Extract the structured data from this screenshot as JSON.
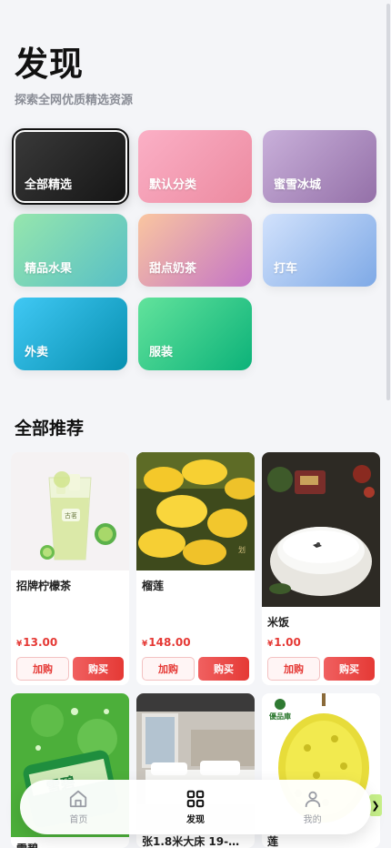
{
  "header": {
    "title": "发现",
    "subtitle": "探索全网优质精选资源"
  },
  "categories": [
    {
      "label": "全部精选",
      "active": true,
      "gradient": [
        "#3a3a3a",
        "#1a1a1a"
      ]
    },
    {
      "label": "默认分类",
      "active": false,
      "gradient": [
        "#f9a8c0",
        "#ee8ea3"
      ]
    },
    {
      "label": "蜜雪冰城",
      "active": false,
      "gradient": [
        "#c6a9d6",
        "#9b74ad"
      ]
    },
    {
      "label": "精品水果",
      "active": false,
      "gradient": [
        "#8fe3ae",
        "#5ec4c5"
      ]
    },
    {
      "label": "甜点奶茶",
      "active": false,
      "gradient": [
        "#f9c2a0",
        "#c979c4"
      ]
    },
    {
      "label": "打车",
      "active": false,
      "gradient": [
        "#c9dcfb",
        "#82aee8"
      ]
    },
    {
      "label": "外卖",
      "active": false,
      "gradient": [
        "#3fc3f0",
        "#0a96b8"
      ]
    },
    {
      "label": "服装",
      "active": false,
      "gradient": [
        "#5fe09a",
        "#0fb57a"
      ]
    }
  ],
  "section": {
    "title": "全部推荐"
  },
  "products": [
    {
      "name": "招牌柠檬茶",
      "currency": "¥",
      "price": "13.00",
      "add_label": "加购",
      "buy_label": "购买"
    },
    {
      "name": "榴莲",
      "currency": "¥",
      "price": "148.00",
      "add_label": "加购",
      "buy_label": "购买"
    },
    {
      "name": "米饭",
      "currency": "¥",
      "price": "1.00",
      "add_label": "加购",
      "buy_label": "购买"
    },
    {
      "name": "雪碧",
      "currency": "¥",
      "price": "",
      "add_label": "",
      "buy_label": ""
    },
    {
      "name": "张1.8米大床 19-…",
      "currency": "¥",
      "price": "",
      "add_label": "",
      "buy_label": ""
    },
    {
      "name": "莲",
      "currency": "¥",
      "price": "",
      "add_label": "",
      "buy_label": ""
    }
  ],
  "tabbar": {
    "items": [
      {
        "label": "首页",
        "icon": "home-icon",
        "active": false
      },
      {
        "label": "发现",
        "icon": "grid-icon",
        "active": true
      },
      {
        "label": "我的",
        "icon": "user-icon",
        "active": false
      }
    ]
  },
  "colors": {
    "price": "#e53935",
    "accent": "#e53935",
    "background": "#f4f5f8"
  }
}
